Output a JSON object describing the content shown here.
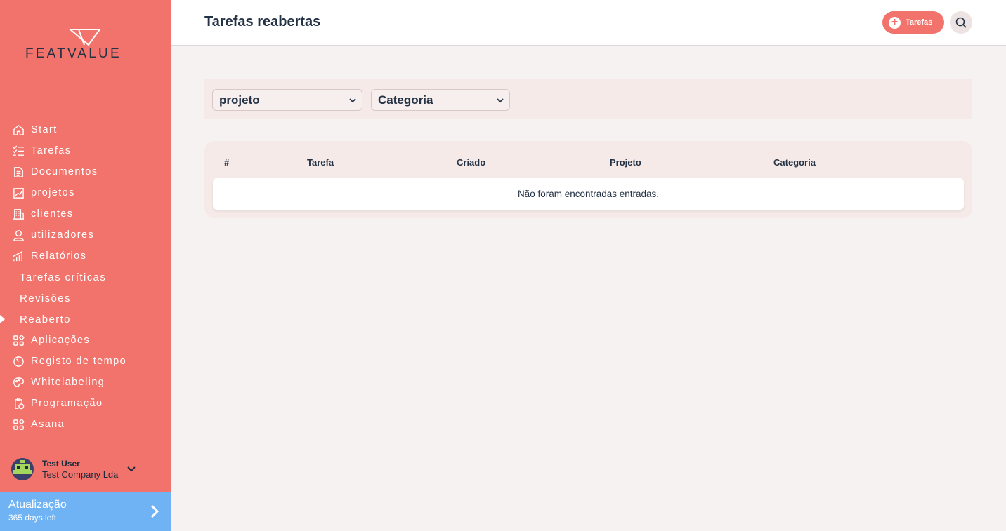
{
  "brand": {
    "logo_text": "FEATVALUE"
  },
  "sidebar": {
    "items": [
      {
        "label": "Start",
        "icon": "home-icon"
      },
      {
        "label": "Tarefas",
        "icon": "checklist-icon"
      },
      {
        "label": "Documentos",
        "icon": "document-icon"
      },
      {
        "label": "projetos",
        "icon": "chart-icon"
      },
      {
        "label": "clientes",
        "icon": "building-icon"
      },
      {
        "label": "utilizadores",
        "icon": "user-icon"
      },
      {
        "label": "Relatórios",
        "icon": "bar-chart-icon"
      },
      {
        "label": "Tarefas críticas",
        "icon": ""
      },
      {
        "label": "Revisões",
        "icon": ""
      },
      {
        "label": "Reaberto",
        "icon": "",
        "active": true
      },
      {
        "label": "Aplicações",
        "icon": "apps-icon"
      },
      {
        "label": "Registo de tempo",
        "icon": "timer-icon"
      },
      {
        "label": "Whitelabeling",
        "icon": "palette-icon"
      },
      {
        "label": "Programação",
        "icon": "clipboard-clock-icon"
      },
      {
        "label": "Asana",
        "icon": "apps-icon"
      }
    ]
  },
  "user": {
    "name": "Test User",
    "company": "Test Company Lda"
  },
  "upgrade": {
    "title": "Atualização",
    "subtitle": "365 days left"
  },
  "header": {
    "title": "Tarefas reabertas",
    "add_label": "Tarefas"
  },
  "filters": {
    "project": "projeto",
    "category": "Categoria"
  },
  "table": {
    "columns": [
      "#",
      "Tarefa",
      "Criado",
      "Projeto",
      "Categoria"
    ],
    "empty_message": "Não foram encontradas entradas."
  },
  "colors": {
    "sidebar": "#f2736b",
    "accent": "#f2736b",
    "upgrade": "#6fb3f4",
    "text_dark": "#243245"
  }
}
